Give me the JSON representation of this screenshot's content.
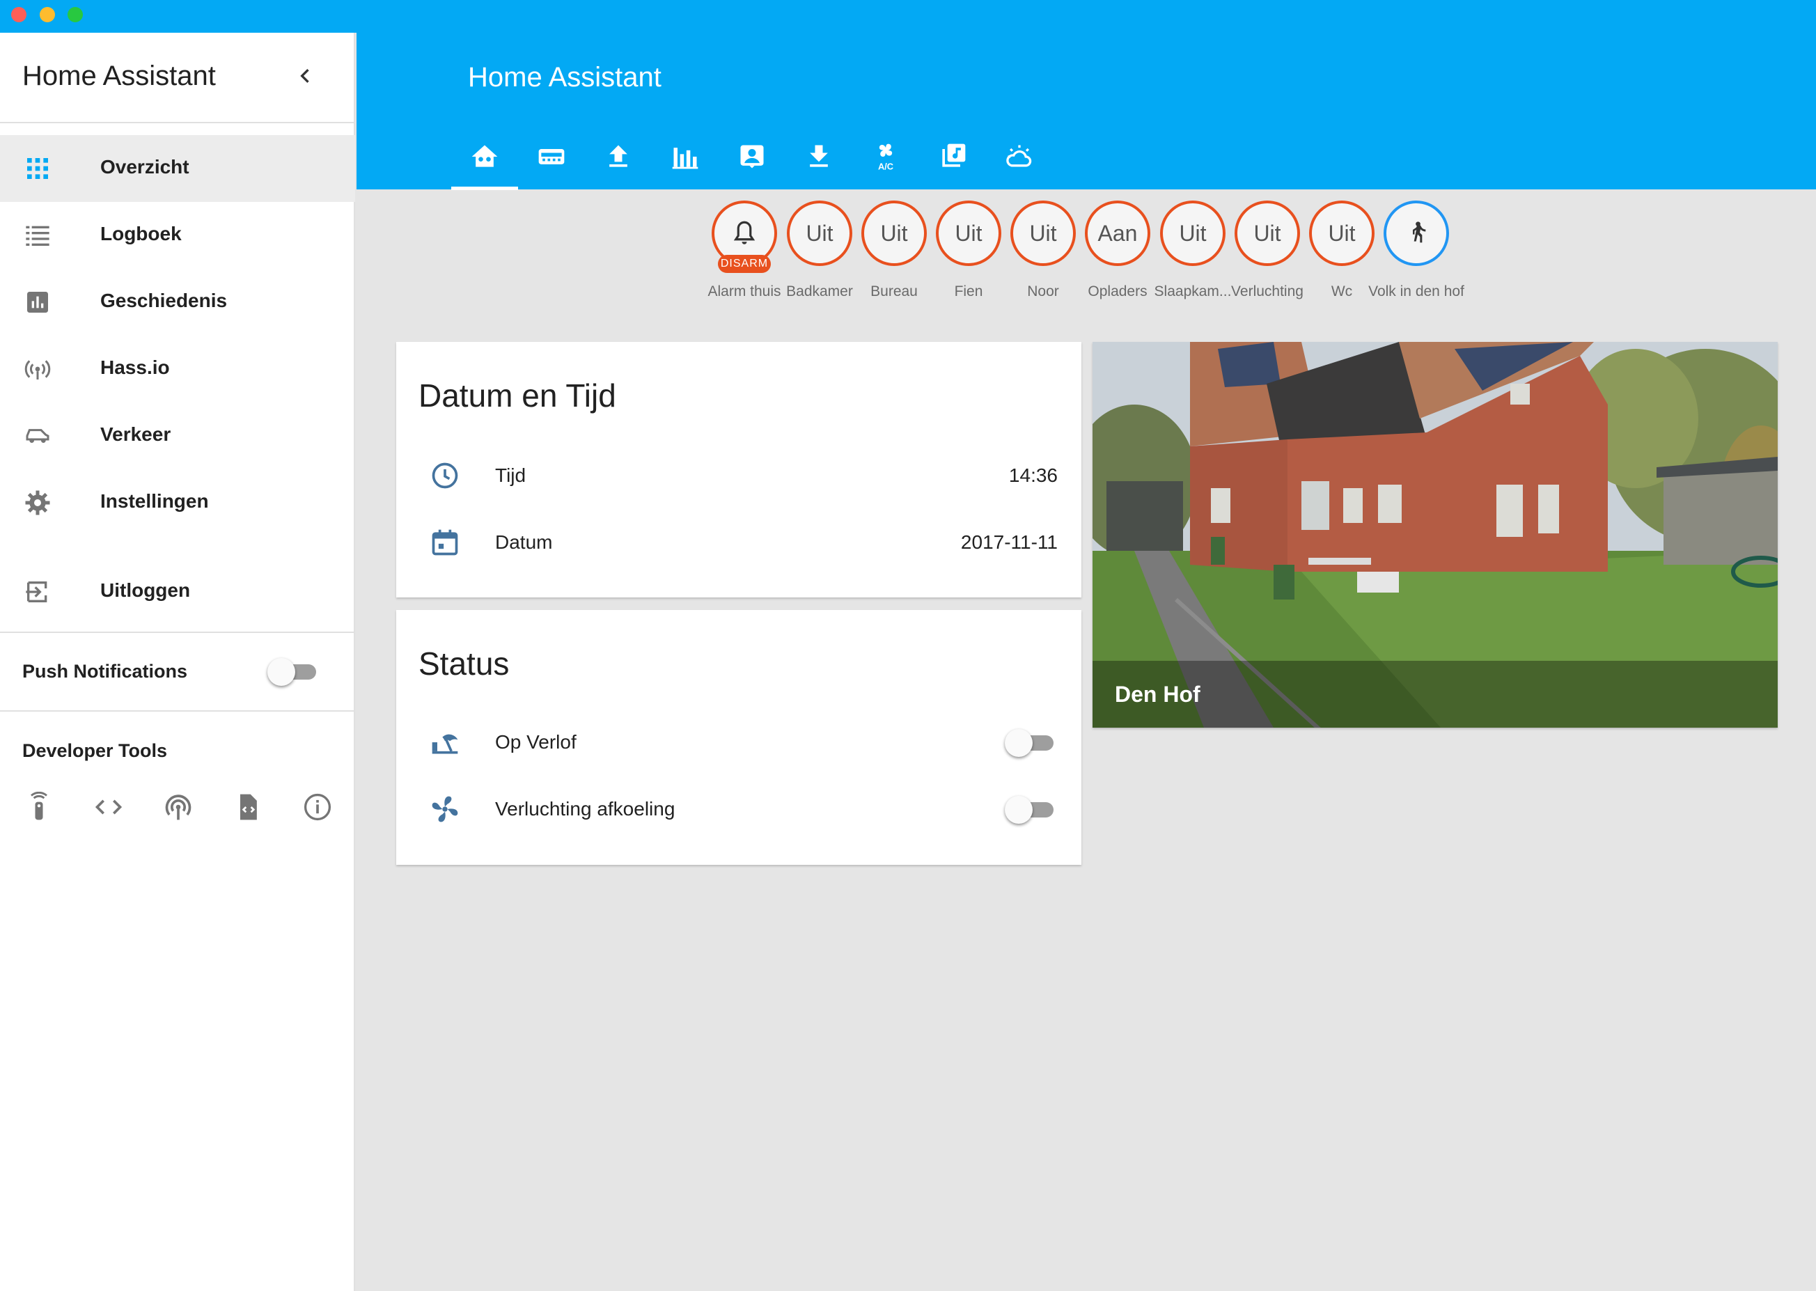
{
  "sidebar": {
    "title": "Home Assistant",
    "nav": [
      {
        "label": "Overzicht",
        "icon": "grid-icon"
      },
      {
        "label": "Logboek",
        "icon": "list-icon"
      },
      {
        "label": "Geschiedenis",
        "icon": "chart-bar-icon"
      },
      {
        "label": "Hass.io",
        "icon": "broadcast-icon"
      },
      {
        "label": "Verkeer",
        "icon": "car-icon"
      },
      {
        "label": "Instellingen",
        "icon": "gear-icon"
      },
      {
        "label": "Uitloggen",
        "icon": "logout-icon"
      }
    ],
    "push_notifications": {
      "label": "Push Notifications",
      "enabled": false
    },
    "developer_tools": {
      "label": "Developer Tools",
      "tools": [
        "remote-icon",
        "code-icon",
        "antenna-icon",
        "file-code-icon",
        "info-icon"
      ]
    }
  },
  "header": {
    "title": "Home Assistant",
    "tabs": [
      "home-icon",
      "router-icon",
      "upload-icon",
      "bar-chart-icon",
      "account-box-icon",
      "download-icon",
      "air-conditioner-icon",
      "music-library-icon",
      "weather-partly-cloudy-icon"
    ],
    "active_tab": 0
  },
  "badges": [
    {
      "value": "",
      "label": "Alarm thuis",
      "icon": "bell-icon",
      "tag": "DISARM"
    },
    {
      "value": "Uit",
      "label": "Badkamer"
    },
    {
      "value": "Uit",
      "label": "Bureau"
    },
    {
      "value": "Uit",
      "label": "Fien"
    },
    {
      "value": "Uit",
      "label": "Noor"
    },
    {
      "value": "Aan",
      "label": "Opladers"
    },
    {
      "value": "Uit",
      "label": "Slaapkam..."
    },
    {
      "value": "Uit",
      "label": "Verluchting"
    },
    {
      "value": "Uit",
      "label": "Wc"
    },
    {
      "value": "",
      "label": "Volk in den hof",
      "icon": "walk-icon"
    }
  ],
  "datetime_card": {
    "title": "Datum en Tijd",
    "rows": [
      {
        "label": "Tijd",
        "value": "14:36",
        "icon": "clock-icon"
      },
      {
        "label": "Datum",
        "value": "2017-11-11",
        "icon": "calendar-icon"
      }
    ]
  },
  "status_card": {
    "title": "Status",
    "rows": [
      {
        "label": "Op Verlof",
        "icon": "beach-icon",
        "on": false
      },
      {
        "label": "Verluchting afkoeling",
        "icon": "fan-icon",
        "on": false
      }
    ]
  },
  "camera": {
    "name": "Den Hof"
  },
  "colors": {
    "primary": "#03a9f4",
    "badge_border": "#e8501e",
    "badge_person": "#2196f3",
    "state_icon": "#44739e"
  }
}
